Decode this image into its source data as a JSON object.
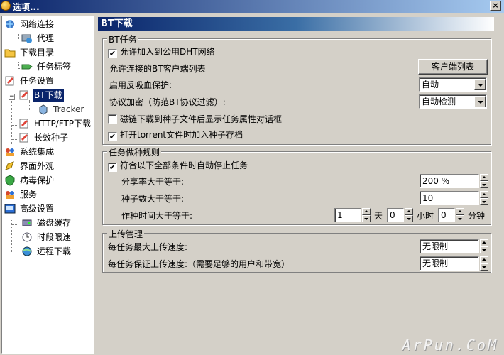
{
  "window": {
    "title": "选项...",
    "close_label": "×"
  },
  "tree": {
    "items": [
      {
        "label": "网络连接",
        "icon": "network-icon"
      },
      {
        "label": "代理",
        "icon": "globe-icon"
      },
      {
        "label": "下载目录",
        "icon": "folder-icon"
      },
      {
        "label": "任务标签",
        "icon": "tag-icon"
      },
      {
        "label": "任务设置",
        "icon": "task-settings-icon"
      },
      {
        "label": "BT下载",
        "icon": "bt-download-icon"
      },
      {
        "label": "Tracker",
        "icon": "tracker-icon"
      },
      {
        "label": "HTTP/FTP下载",
        "icon": "http-ftp-icon"
      },
      {
        "label": "长效种子",
        "icon": "seed-icon"
      },
      {
        "label": "系统集成",
        "icon": "system-integration-icon"
      },
      {
        "label": "界面外观",
        "icon": "appearance-icon"
      },
      {
        "label": "病毒保护",
        "icon": "virus-shield-icon"
      },
      {
        "label": "服务",
        "icon": "service-icon"
      },
      {
        "label": "高级设置",
        "icon": "advanced-settings-icon"
      },
      {
        "label": "磁盘缓存",
        "icon": "disk-cache-icon"
      },
      {
        "label": "时段限速",
        "icon": "time-limit-icon"
      },
      {
        "label": "远程下载",
        "icon": "remote-download-icon"
      }
    ],
    "expander_minus": "−"
  },
  "panel": {
    "title": "BT下载"
  },
  "bt_group": {
    "legend": "BT任务",
    "dht_label": "允许加入到公用DHT网络",
    "dht_checked": "✔",
    "client_list_label": "允许连接的BT客户端列表",
    "client_list_button": "客户端列表",
    "anti_leech_label": "启用反吸血保护:",
    "anti_leech_value": "自动",
    "encryption_label": "协议加密（防范BT协议过滤）:",
    "encryption_value": "自动检测",
    "magnet_label": "磁链下载到种子文件后显示任务属性对话框",
    "magnet_checked": "",
    "torrent_label": "打开torrent文件时加入种子存档",
    "torrent_checked": "✔"
  },
  "seed_group": {
    "legend": "任务做种规则",
    "auto_stop_label": "符合以下全部条件时自动停止任务",
    "auto_stop_checked": "✔",
    "share_ratio_label": "分享率大于等于:",
    "share_ratio_value": "200 %",
    "seed_count_label": "种子数大于等于:",
    "seed_count_value": "10",
    "seed_time_label": "作种时间大于等于:",
    "days_value": "1",
    "days_unit": "天",
    "hours_value": "0",
    "hours_unit": "小时",
    "minutes_value": "0",
    "minutes_unit": "分钟"
  },
  "upload_group": {
    "legend": "上传管理",
    "max_upload_label": "每任务最大上传速度:",
    "max_upload_value": "无限制",
    "guaranteed_upload_label": "每任务保证上传速度:（需要足够的用户和带宽）",
    "guaranteed_upload_value": "无限制"
  },
  "watermark": "ArPun.CoM"
}
